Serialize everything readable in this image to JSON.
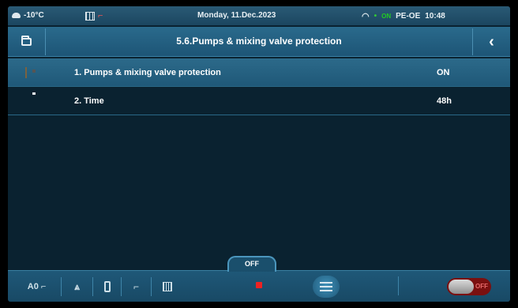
{
  "status_bar": {
    "outdoor_temp": "-10°C",
    "date": "Monday, 11.Dec.2023",
    "on_tag": "ON",
    "device": "PE-OE",
    "time": "10:48"
  },
  "header": {
    "title": "5.6.Pumps & mixing valve protection",
    "folder_icon": "folder-icon",
    "back_icon": "chevron-left-icon"
  },
  "rows": [
    {
      "icon": "pump-icon",
      "label": "1.  Pumps & mixing valve protection",
      "value": "ON"
    },
    {
      "icon": "timer-icon",
      "label": "2.  Time",
      "value": "48h"
    }
  ],
  "bottom_bar": {
    "mode_label": "A0",
    "off_label": "OFF",
    "toggle_label": "OFF"
  },
  "colors": {
    "background": "#0a2230",
    "header": "#1d5576",
    "stop_red": "#e22222"
  }
}
